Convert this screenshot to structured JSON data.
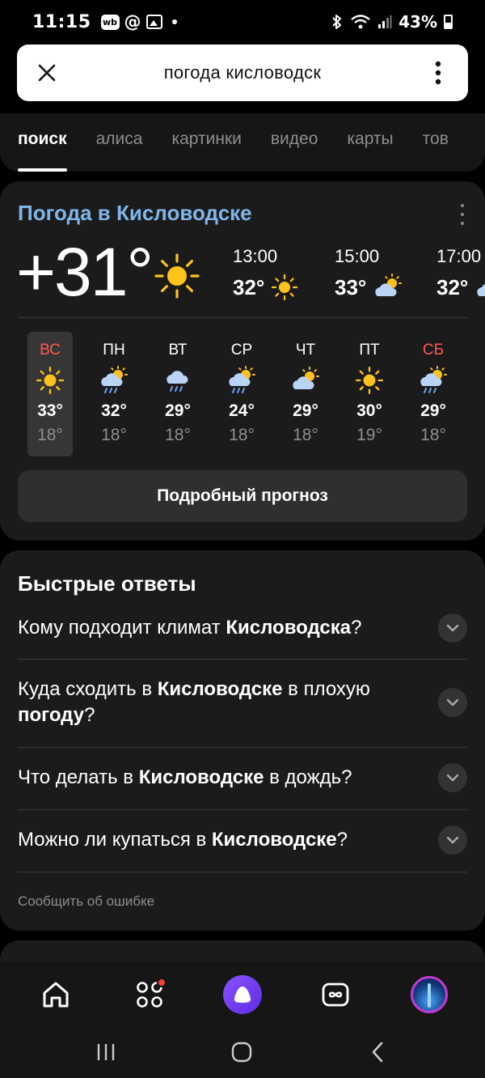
{
  "status_bar": {
    "time": "11:15",
    "wb_label": "wb",
    "at_symbol": "@",
    "battery": "43%"
  },
  "search": {
    "query": "погода кисловодск"
  },
  "tabs": [
    {
      "label": "поиск",
      "active": true
    },
    {
      "label": "алиса",
      "active": false
    },
    {
      "label": "картинки",
      "active": false
    },
    {
      "label": "видео",
      "active": false
    },
    {
      "label": "карты",
      "active": false
    },
    {
      "label": "тов",
      "active": false
    }
  ],
  "weather": {
    "title": "Погода в Кисловодске",
    "current_temp": "+31°",
    "current_icon": "sun-icon",
    "hourly": [
      {
        "time": "13:00",
        "temp": "32°",
        "icon": "sun-icon"
      },
      {
        "time": "15:00",
        "temp": "33°",
        "icon": "partly-cloudy-icon"
      },
      {
        "time": "17:00",
        "temp": "32°",
        "icon": "partly-cloudy-icon"
      }
    ],
    "days": [
      {
        "name": "ВС",
        "high": "33°",
        "low": "18°",
        "icon": "sun-icon",
        "weekend": true,
        "selected": true
      },
      {
        "name": "ПН",
        "high": "32°",
        "low": "18°",
        "icon": "sun-cloud-rain-icon",
        "weekend": false,
        "selected": false
      },
      {
        "name": "ВТ",
        "high": "29°",
        "low": "18°",
        "icon": "cloud-rain-icon",
        "weekend": false,
        "selected": false
      },
      {
        "name": "СР",
        "high": "24°",
        "low": "18°",
        "icon": "sun-cloud-rain-icon",
        "weekend": false,
        "selected": false
      },
      {
        "name": "ЧТ",
        "high": "29°",
        "low": "18°",
        "icon": "partly-cloudy-icon",
        "weekend": false,
        "selected": false
      },
      {
        "name": "ПТ",
        "high": "30°",
        "low": "19°",
        "icon": "sun-icon",
        "weekend": false,
        "selected": false
      },
      {
        "name": "СБ",
        "high": "29°",
        "low": "18°",
        "icon": "sun-cloud-rain-icon",
        "weekend": true,
        "selected": false
      }
    ],
    "forecast_button": "Подробный прогноз"
  },
  "quick_answers": {
    "title": "Быстрые ответы",
    "items": [
      {
        "parts": [
          {
            "t": "Кому подходит климат ",
            "b": false
          },
          {
            "t": "Кисловодска",
            "b": true
          },
          {
            "t": "?",
            "b": false
          }
        ]
      },
      {
        "parts": [
          {
            "t": "Куда сходить в ",
            "b": false
          },
          {
            "t": "Кисловодске",
            "b": true
          },
          {
            "t": " в плохую ",
            "b": false
          },
          {
            "t": "погоду",
            "b": true
          },
          {
            "t": "?",
            "b": false
          }
        ]
      },
      {
        "parts": [
          {
            "t": "Что делать в ",
            "b": false
          },
          {
            "t": "Кисловодске",
            "b": true
          },
          {
            "t": " в дождь?",
            "b": false
          }
        ]
      },
      {
        "parts": [
          {
            "t": "Можно ли купаться в ",
            "b": false
          },
          {
            "t": "Кисловодске",
            "b": true
          },
          {
            "t": "?",
            "b": false
          }
        ]
      }
    ],
    "report_error": "Сообщить об ошибке"
  },
  "bottom_nav": [
    {
      "name": "home-icon"
    },
    {
      "name": "services-icon",
      "badge": true
    },
    {
      "name": "alice-icon"
    },
    {
      "name": "infinity-icon"
    },
    {
      "name": "avatar"
    }
  ],
  "colors": {
    "accent_link": "#7fb6e9",
    "weekend_red": "#ff5a4e",
    "sun": "#ffc21a",
    "cloud": "#b9d4f5",
    "alice": "#7a45f5"
  }
}
